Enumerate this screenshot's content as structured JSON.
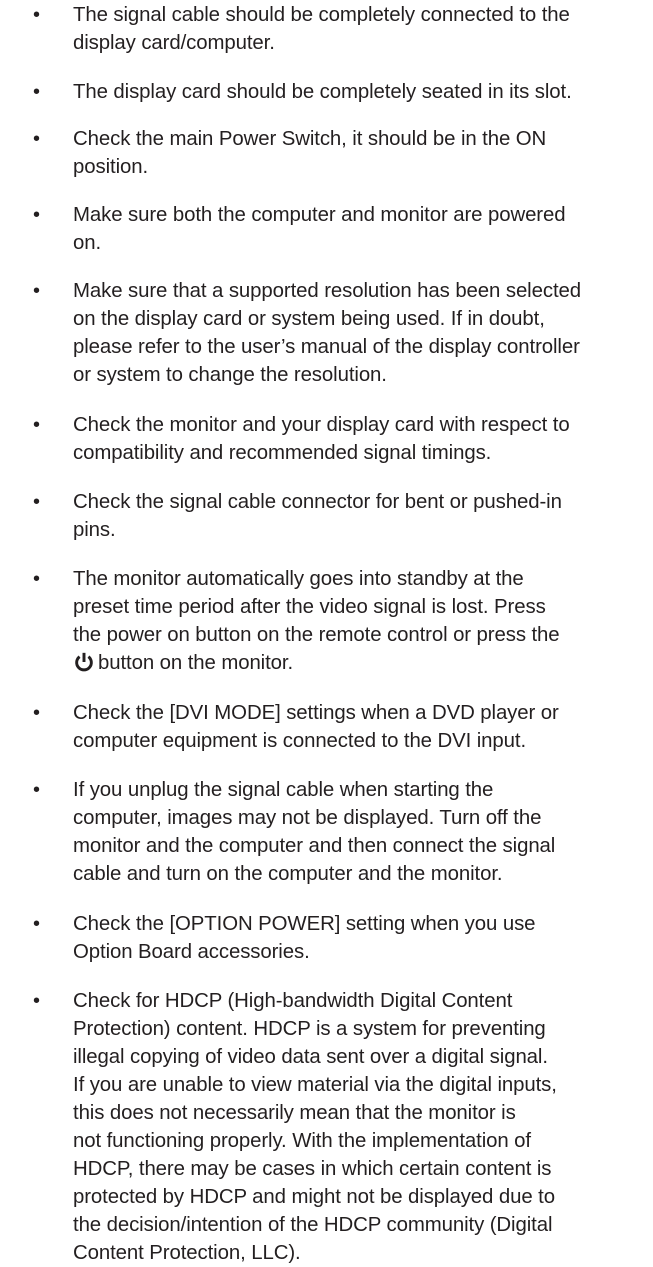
{
  "items": [
    {
      "lines": [
        "The signal cable should be completely connected to the",
        "display card/computer."
      ]
    },
    {
      "lines": [
        "The display card should be completely seated in its slot."
      ]
    },
    {
      "lines": [
        "Check the main Power Switch, it should be in the ON",
        "position."
      ]
    },
    {
      "lines": [
        "Make sure both the computer and monitor are powered",
        "on."
      ]
    },
    {
      "lines": [
        "Make sure that a supported resolution has been selected",
        "on the display card or system being used. If in doubt,",
        "please refer to the user’s manual of the display controller",
        "or system to change the resolution."
      ]
    },
    {
      "lines": [
        "Check the monitor and your display card with respect to",
        "compatibility and recommended signal timings."
      ]
    },
    {
      "lines": [
        "Check the signal cable connector for bent or pushed-in",
        "pins."
      ]
    },
    {
      "lines": [
        "The monitor automatically goes into standby at the",
        "preset time period after the video signal is lost. Press",
        "the power on button on the remote control or press the",
        "button on the monitor."
      ],
      "icon": "power-icon"
    },
    {
      "lines": [
        "Check the [DVI MODE] settings when a DVD player or",
        "computer equipment is connected to the DVI input."
      ]
    },
    {
      "lines": [
        "If you unplug the signal cable when starting the",
        "computer, images may not be displayed. Turn off the",
        "monitor and the computer and then connect the signal",
        "cable and turn on the computer and the monitor."
      ]
    },
    {
      "lines": [
        "Check the [OPTION POWER] setting when you use",
        "Option Board accessories."
      ]
    },
    {
      "lines": [
        "Check for HDCP (High-bandwidth Digital Content",
        "Protection) content. HDCP is a system for preventing",
        "illegal copying of video data sent over a digital signal.",
        "If you are unable to view material via the digital inputs,",
        "this does not necessarily mean that the monitor is",
        "not functioning properly. With the implementation of",
        "HDCP, there may be cases in which certain content is",
        "protected by HDCP and might not be displayed due to",
        "the decision/intention of the HDCP community (Digital",
        "Content Protection, LLC)."
      ]
    }
  ],
  "bullet_char": "•"
}
